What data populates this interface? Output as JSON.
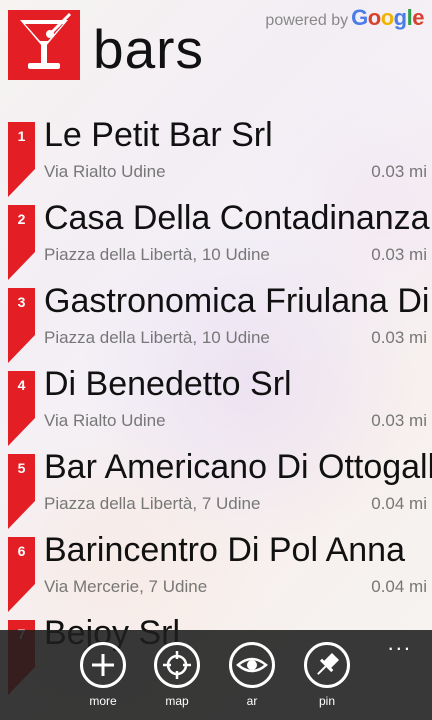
{
  "header": {
    "title": "bars",
    "powered_by": "powered by",
    "google": [
      "G",
      "o",
      "o",
      "g",
      "l",
      "e"
    ]
  },
  "colors": {
    "accent": "#e31e24",
    "appbar": "#1e1e1e"
  },
  "items": [
    {
      "rank": "1",
      "name": "Le Petit Bar Srl",
      "address": "Via Rialto Udine",
      "distance": "0.03 mi"
    },
    {
      "rank": "2",
      "name": "Casa Della Contadinanza",
      "address": "Piazza della Libertà, 10 Udine",
      "distance": "0.03 mi"
    },
    {
      "rank": "3",
      "name": "Gastronomica Friulana Di",
      "address": "Piazza della Libertà, 10 Udine",
      "distance": "0.03 mi"
    },
    {
      "rank": "4",
      "name": "Di Benedetto Srl",
      "address": "Via Rialto Udine",
      "distance": "0.03 mi"
    },
    {
      "rank": "5",
      "name": "Bar Americano Di Ottogalli",
      "address": "Piazza della Libertà, 7 Udine",
      "distance": "0.04 mi"
    },
    {
      "rank": "6",
      "name": "Barincentro Di Pol Anna",
      "address": "Via Mercerie, 7 Udine",
      "distance": "0.04 mi"
    },
    {
      "rank": "7",
      "name": "Bejoy Srl",
      "address": "",
      "distance": ""
    }
  ],
  "appbar": {
    "ellipsis": "...",
    "buttons": [
      {
        "label": "more",
        "icon": "add-icon"
      },
      {
        "label": "map",
        "icon": "crosshair-icon"
      },
      {
        "label": "ar",
        "icon": "eye-icon"
      },
      {
        "label": "pin",
        "icon": "pin-icon"
      }
    ]
  }
}
